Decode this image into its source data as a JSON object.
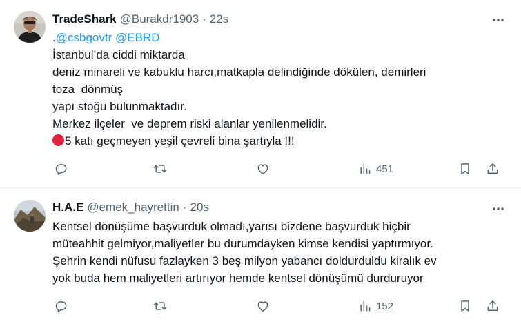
{
  "tweets": [
    {
      "name": "TradeShark",
      "handle": "@Burakdr1903",
      "separator": "·",
      "time": "22s",
      "mentions_prefix": ".",
      "mention1": "@csbgovtr",
      "mention2": "@EBRD",
      "lines": [
        "İstanbul’da ciddi miktarda",
        "deniz minareli ve kabuklu harcı,matkapla delindiğinde dökülen, demirleri",
        "toza  dönmüş",
        "yapı stoğu bulunmaktadır.",
        "Merkez ilçeler  ve deprem riski alanlar yenilenmelidir.",
        "5 katı geçmeyen yeşil çevreli bina şartıyla !!!"
      ],
      "views": "451"
    },
    {
      "name": "H.A.E",
      "handle": "@emek_hayrettin",
      "separator": "·",
      "time": "20s",
      "lines": [
        "Kentsel dönüşüme başvurduk olmadı,yarısı bizdene başvurduk hiçbir",
        "müteahhit gelmiyor,maliyetler bu durumdayken kimse kendisi yaptırmıyor.",
        "Şehrin kendi nüfusu fazlayken 3 beş milyon yabancı doldurduldu kiralık ev",
        "yok buda hem maliyetleri artırıyor hemde kentsel dönüşümü durduruyor"
      ],
      "views": "152"
    }
  ],
  "icons": {
    "reply": "reply-icon",
    "retweet": "retweet-icon",
    "like": "like-icon",
    "views": "views-icon",
    "bookmark": "bookmark-icon",
    "share": "share-icon",
    "more": "more-icon",
    "red_circle": "red-circle-emoji"
  },
  "colors": {
    "text": "#0f1419",
    "secondary": "#536471",
    "link": "#1d9bf0",
    "divider": "#eff3f4"
  }
}
